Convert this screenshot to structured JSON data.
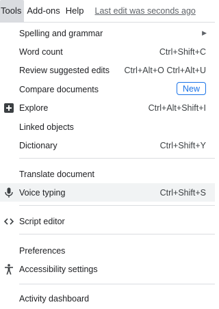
{
  "menubar": {
    "tools_label": "Tools",
    "addons_label": "Add-ons",
    "help_label": "Help",
    "last_edit": "Last edit was seconds ago"
  },
  "menu": {
    "spelling_label": "Spelling and grammar",
    "word_count_label": "Word count",
    "word_count_shortcut": "Ctrl+Shift+C",
    "review_label": "Review suggested edits",
    "review_shortcut": "Ctrl+Alt+O Ctrl+Alt+U",
    "compare_label": "Compare documents",
    "compare_badge": "New",
    "explore_label": "Explore",
    "explore_shortcut": "Ctrl+Alt+Shift+I",
    "linked_label": "Linked objects",
    "dictionary_label": "Dictionary",
    "dictionary_shortcut": "Ctrl+Shift+Y",
    "translate_label": "Translate document",
    "voice_label": "Voice typing",
    "voice_shortcut": "Ctrl+Shift+S",
    "script_label": "Script editor",
    "preferences_label": "Preferences",
    "accessibility_label": "Accessibility settings",
    "activity_label": "Activity dashboard"
  },
  "colors": {
    "accent": "#1a73e8",
    "hover_bg": "#f1f3f4",
    "active_menu_bg": "#dadce0",
    "separator": "#dadce0"
  },
  "icons": {
    "explore": "explore-plus-icon",
    "voice": "microphone-icon",
    "script": "code-brackets-icon",
    "accessibility": "accessibility-person-icon",
    "submenu": "submenu-arrow-icon"
  }
}
